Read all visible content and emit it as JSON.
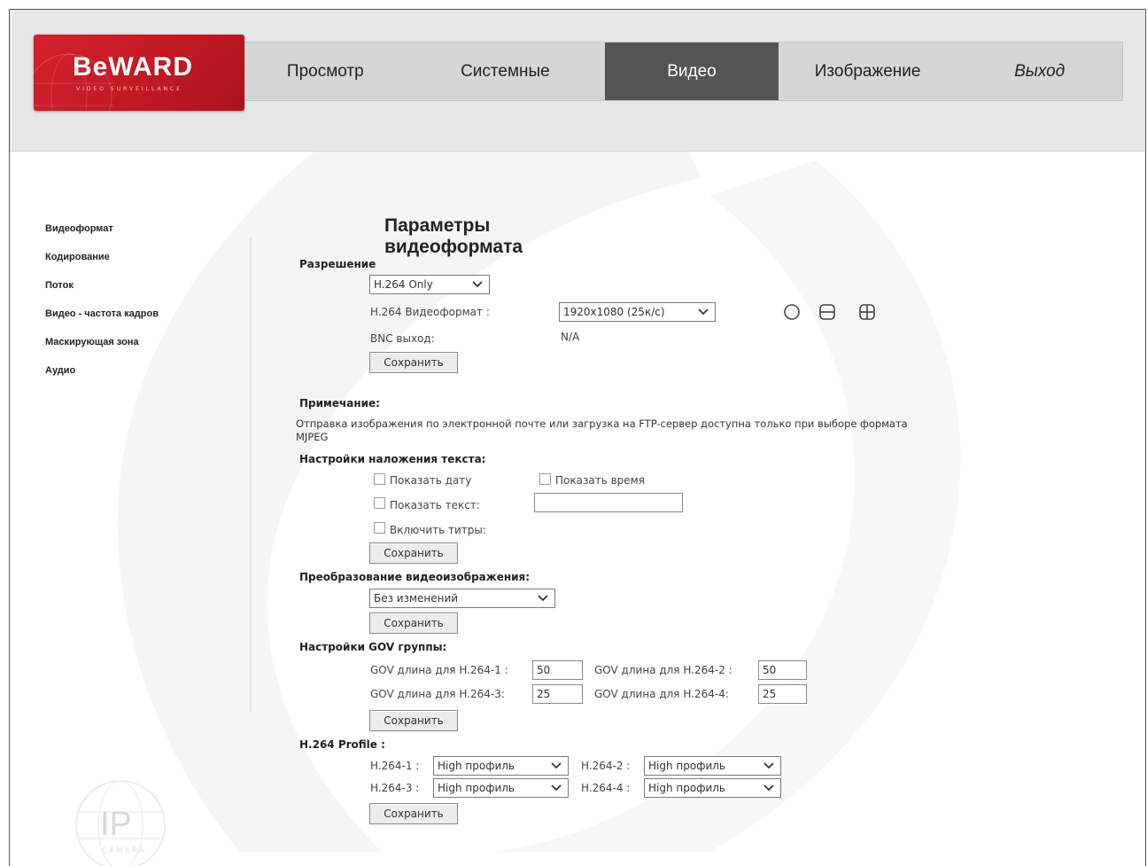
{
  "header": {
    "logo_text": "BeWARD",
    "logo_subtext": "VIDEO SURVEILLANCE",
    "nav": [
      {
        "label": "Просмотр"
      },
      {
        "label": "Системные"
      },
      {
        "label": "Видео"
      },
      {
        "label": "Изображение"
      },
      {
        "label": "Выход"
      }
    ]
  },
  "sidebar": {
    "items": [
      {
        "label": "Видеоформат"
      },
      {
        "label": "Кодирование"
      },
      {
        "label": "Поток"
      },
      {
        "label": "Видео - частота кадров"
      },
      {
        "label": "Маскирующая зона"
      },
      {
        "label": "Аудио"
      }
    ]
  },
  "main": {
    "title": "Параметры видеоформата",
    "resolution": {
      "heading": "Разрешение",
      "mode_value": "H.264 Only",
      "format_label": "H.264 Видеоформат :",
      "format_value": "1920x1080 (25к/с)",
      "bnc_label": "BNC выход:",
      "bnc_value": "N/A",
      "save": "Сохранить"
    },
    "note": {
      "heading": "Примечание:",
      "text": "Отправка изображения по электронной почте или загрузка на FTP-сервер доступна только при выборе формата MJPEG"
    },
    "overlay": {
      "heading": "Настройки наложения текста:",
      "show_date": "Показать дату",
      "show_time": "Показать время",
      "show_text": "Показать текст:",
      "text_value": "",
      "subtitles": "Включить титры:",
      "save": "Сохранить"
    },
    "transform": {
      "heading": "Преобразование видеоизображения:",
      "value": "Без изменений",
      "save": "Сохранить"
    },
    "gov": {
      "heading": "Настройки GOV группы:",
      "rows": [
        {
          "label1": "GOV длина для H.264-1 :",
          "value1": "50",
          "label2": "GOV длина для H.264-2 :",
          "value2": "50"
        },
        {
          "label1": "GOV длина для H.264-3:",
          "value1": "25",
          "label2": "GOV длина для H.264-4:",
          "value2": "25"
        }
      ],
      "save": "Сохранить"
    },
    "profile": {
      "heading": "H.264 Profile :",
      "rows": [
        {
          "label1": "H.264-1 :",
          "value1": "High профиль",
          "label2": "H.264-2 :",
          "value2": "High профиль"
        },
        {
          "label1": "H.264-3 :",
          "value1": "High профиль",
          "label2": "H.264-4 :",
          "value2": "High профиль"
        }
      ],
      "save": "Сохранить"
    }
  },
  "watermark": {
    "text": "IP",
    "subtext": "CAMERA"
  },
  "colors": {
    "brand_red": "#d4212e",
    "nav_bg": "#d6d6d6",
    "nav_active": "#545454",
    "header_bg": "#e7e7e7"
  }
}
